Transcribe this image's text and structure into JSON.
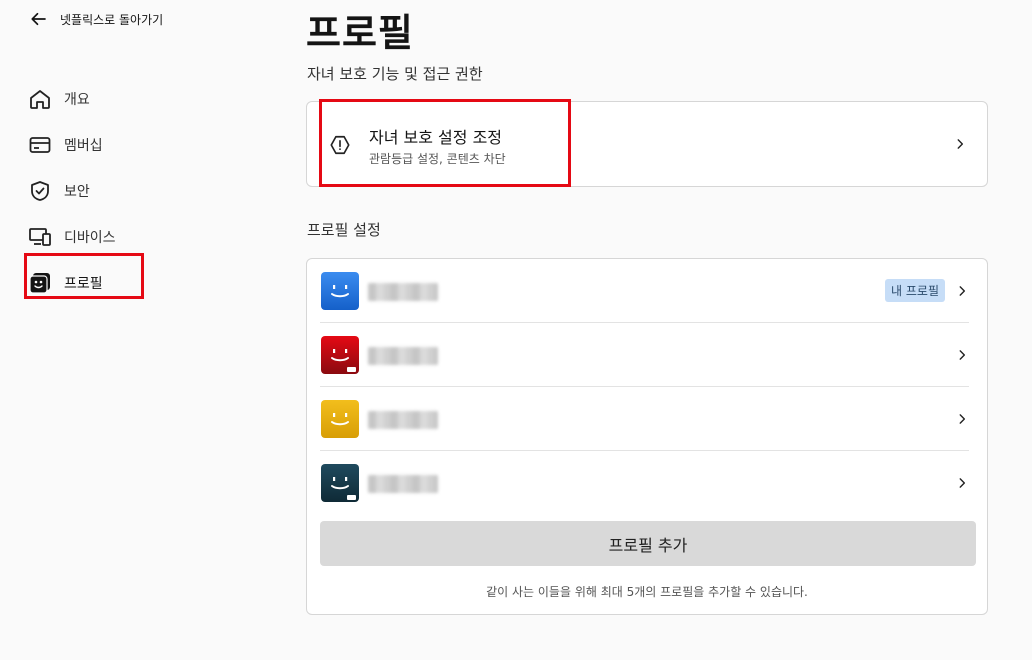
{
  "sidebar": {
    "back_label": "넷플릭스로 돌아가기",
    "items": [
      {
        "label": "개요",
        "icon": "home-icon"
      },
      {
        "label": "멤버십",
        "icon": "card-icon"
      },
      {
        "label": "보안",
        "icon": "shield-icon"
      },
      {
        "label": "디바이스",
        "icon": "devices-icon"
      },
      {
        "label": "프로필",
        "icon": "profiles-icon",
        "active": true
      }
    ]
  },
  "main": {
    "title": "프로필",
    "parental": {
      "section_label": "자녀 보호 기능 및 접근 권한",
      "title": "자녀 보호 설정 조정",
      "subtitle": "관람등급 설정, 콘텐츠 차단",
      "icon": "alert-icon"
    },
    "profiles": {
      "section_label": "프로필 설정",
      "my_profile_badge": "내 프로필",
      "list": [
        {
          "avatar_color": "#1a73e8",
          "is_mine": true,
          "kids": false
        },
        {
          "avatar_color": "#e50914",
          "is_mine": false,
          "kids": true
        },
        {
          "avatar_color": "#e6b00a",
          "is_mine": false,
          "kids": false
        },
        {
          "avatar_color": "#1b3a4b",
          "is_mine": false,
          "kids": true
        }
      ],
      "add_button": "프로필 추가",
      "add_note": "같이 사는 이들을 위해 최대 5개의 프로필을 추가할 수 있습니다."
    }
  },
  "colors": {
    "highlight_box": "#e50914",
    "badge_bg": "#c6ddf7"
  }
}
